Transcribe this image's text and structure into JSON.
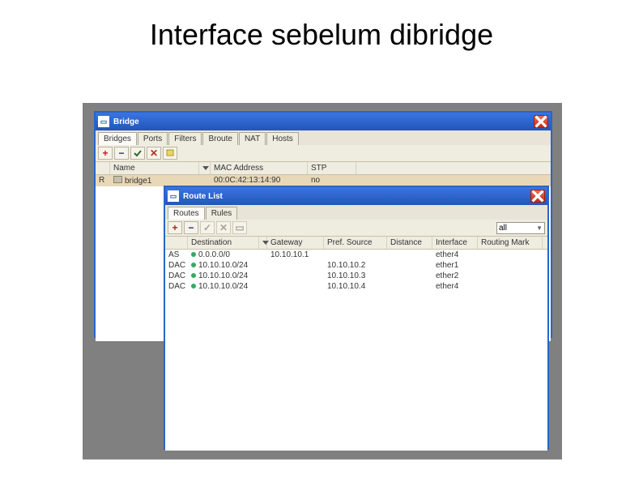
{
  "slide": {
    "title": "Interface sebelum dibridge"
  },
  "bridge": {
    "title": "Bridge",
    "tabs": [
      "Bridges",
      "Ports",
      "Filters",
      "Broute",
      "NAT",
      "Hosts"
    ],
    "active_tab": 0,
    "cols": {
      "name": "Name",
      "mac": "MAC Address",
      "stp": "STP"
    },
    "row0": {
      "flag": "R",
      "name": "bridge1",
      "mac": "00:0C:42:13:14:90",
      "stp": "no"
    }
  },
  "route": {
    "title": "Route List",
    "tabs": [
      "Routes",
      "Rules"
    ],
    "active_tab": 0,
    "filter": "all",
    "cols": {
      "dst": "Destination",
      "gw": "Gateway",
      "pref": "Pref. Source",
      "dist": "Distance",
      "iface": "Interface",
      "rmark": "Routing Mark"
    },
    "rows": [
      {
        "flags": "AS",
        "dst": "0.0.0.0/0",
        "gw": "10.10.10.1",
        "pref": "",
        "iface": "ether4"
      },
      {
        "flags": "DAC",
        "dst": "10.10.10.0/24",
        "gw": "",
        "pref": "10.10.10.2",
        "iface": "ether1"
      },
      {
        "flags": "DAC",
        "dst": "10.10.10.0/24",
        "gw": "",
        "pref": "10.10.10.3",
        "iface": "ether2"
      },
      {
        "flags": "DAC",
        "dst": "10.10.10.0/24",
        "gw": "",
        "pref": "10.10.10.4",
        "iface": "ether4"
      }
    ]
  }
}
